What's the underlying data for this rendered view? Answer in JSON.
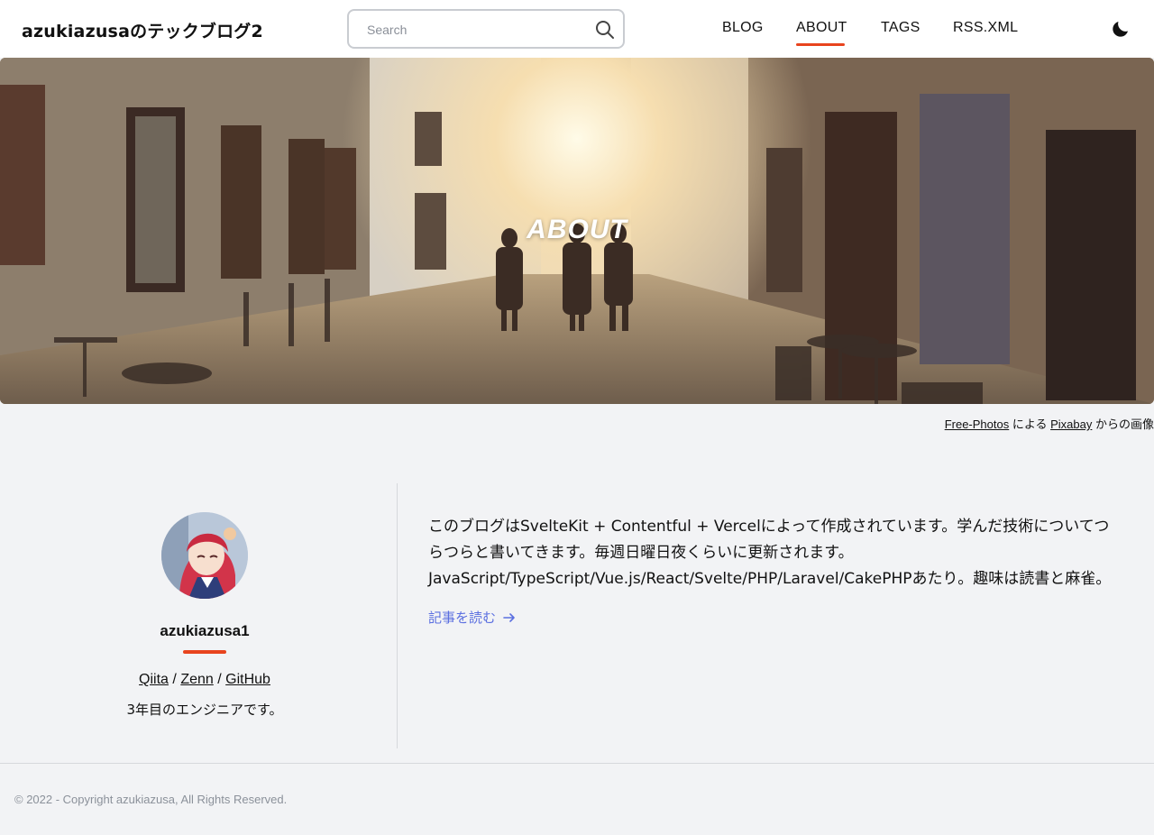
{
  "header": {
    "site_title": "azukiazusaのテックブログ2",
    "search_placeholder": "Search",
    "nav": [
      {
        "label": "BLOG"
      },
      {
        "label": "ABOUT",
        "active": true
      },
      {
        "label": "TAGS"
      },
      {
        "label": "RSS.XML"
      }
    ],
    "theme_icon": "moon-icon"
  },
  "hero": {
    "title": "ABOUT"
  },
  "credit": {
    "author": "Free-Photos",
    "mid": "による",
    "site": "Pixabay",
    "suffix": "からの画像"
  },
  "profile": {
    "name": "azukiazusa1",
    "links": [
      "Qiita",
      "Zenn",
      "GitHub"
    ],
    "separator": "/",
    "bio": "3年目のエンジニアです。"
  },
  "about": {
    "description": "このブログはSvelteKit + Contentful + Vercelによって作成されています。学んだ技術についてつらつらと書いてきます。毎週日曜日夜くらいに更新されます。JavaScript/TypeScript/Vue.js/React/Svelte/PHP/Laravel/CakePHPあたり。趣味は読書と麻雀。",
    "read_more": "記事を読む",
    "read_more_icon": "arrow-right-icon"
  },
  "footer": {
    "copyright": "© 2022 - Copyright azukiazusa, All Rights Reserved."
  },
  "colors": {
    "accent": "#e8441e",
    "link": "#5b6fe0",
    "background": "#f2f3f5"
  }
}
